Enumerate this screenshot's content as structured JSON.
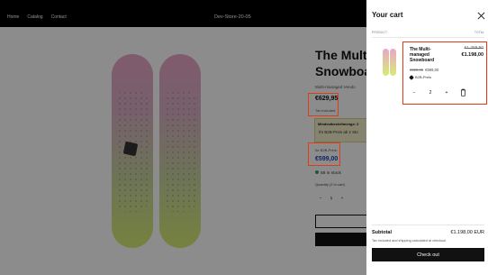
{
  "header": {
    "nav": [
      "Home",
      "Catalog",
      "Contact"
    ],
    "store_name": "Dev-Store-20-05"
  },
  "product": {
    "title_line1": "The Multi",
    "title_line2": "Snowboa",
    "vendor": "Multi-managed Vendo",
    "price": "€629,95",
    "tax_note": "Tax included.",
    "promo_heading": "Mindestbestellmenge: 2",
    "promo_text": "Ihr B2B-Preis ab 2 Stü",
    "b2b_label": "Ihr B2B-Preis:",
    "b2b_price": "€599,00",
    "stock": "58 in stock",
    "quantity_label": "Quantity (2 in cart)",
    "quantity_minus": "−",
    "quantity_value": "1",
    "quantity_plus": "+"
  },
  "cart": {
    "title": "Your cart",
    "col_product": "PRODUCT",
    "col_total": "TOTAL",
    "item": {
      "name": "The Multi-managed Snowboard",
      "old_total": "€1.259,90",
      "new_total": "€1.198,00",
      "old_unit": "€629,95",
      "new_unit": "€599,00",
      "discount_tag": "B2B-Preis",
      "qty_minus": "−",
      "qty_value": "2",
      "qty_plus": "+"
    },
    "subtotal_label": "Subtotal",
    "subtotal_value": "€1.198,00 EUR",
    "tax_note": "Tax included and shipping calculated at checkout",
    "checkout_label": "Check out"
  },
  "colors": {
    "highlight": "#e23a12",
    "b2b_price": "#1c47b8",
    "stock_dot": "#3aa655"
  },
  "icons": [
    "close-icon",
    "trash-icon",
    "tag-icon"
  ]
}
